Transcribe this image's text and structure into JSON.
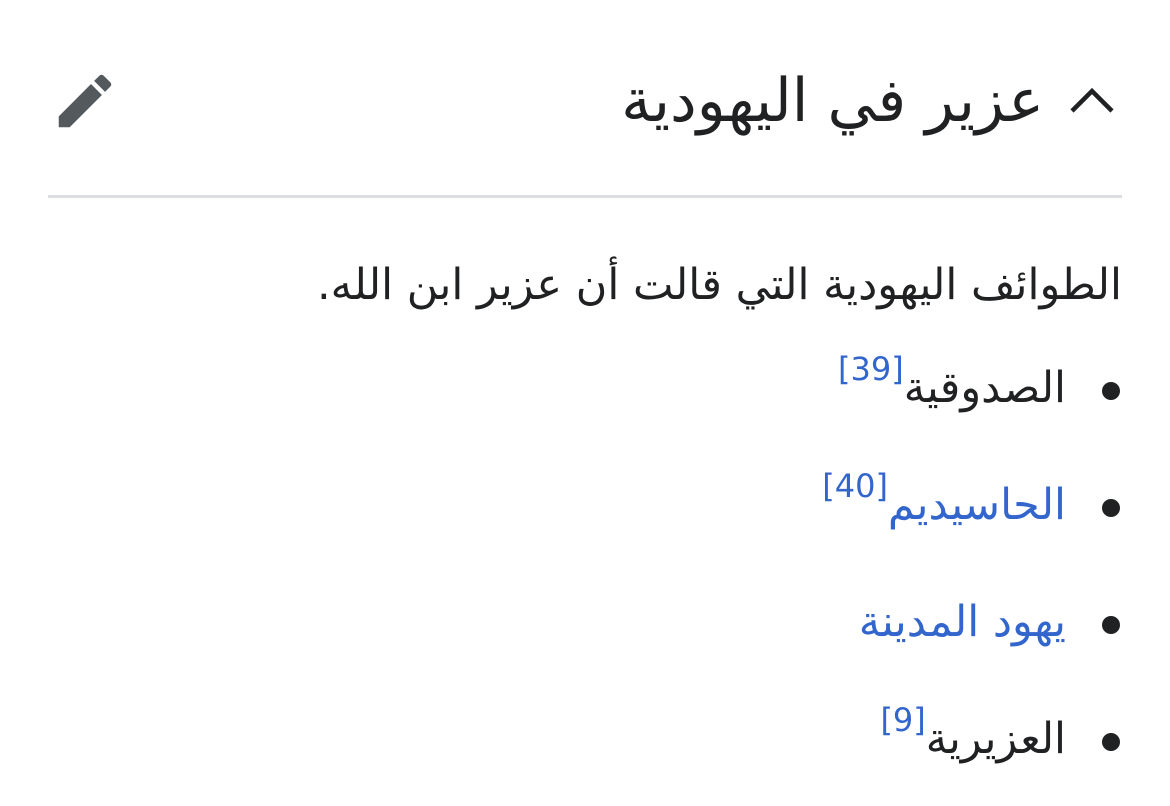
{
  "section": {
    "heading": "عزير في اليهودية",
    "chevron_icon": "chevron-up-icon",
    "edit_icon": "pencil-icon"
  },
  "content": {
    "intro": "الطوائف اليهودية التي قالت أن عزير ابن الله.",
    "items": [
      {
        "label": "الصدوقية",
        "is_link": false,
        "ref": "[39]"
      },
      {
        "label": "الحاسيديم",
        "is_link": true,
        "ref": "[40]"
      },
      {
        "label": "يهود المدينة",
        "is_link": true,
        "ref": ""
      },
      {
        "label": "العزيرية",
        "is_link": false,
        "ref": "[9]"
      }
    ]
  },
  "colors": {
    "text": "#202122",
    "link": "#3366cc",
    "divider": "#dcdde0",
    "icon": "#54595d"
  }
}
